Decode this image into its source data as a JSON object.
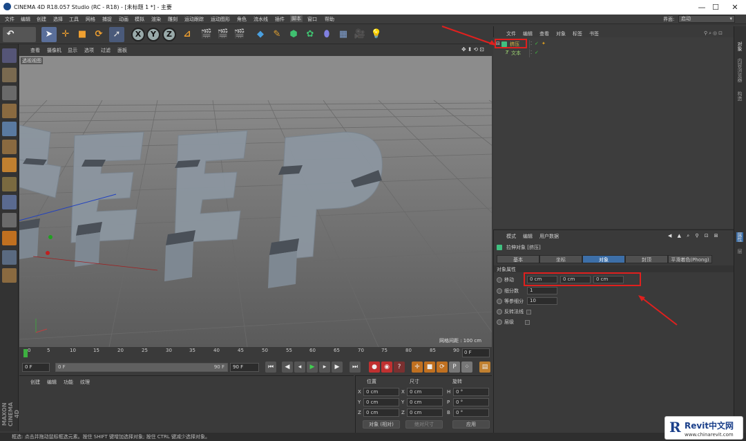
{
  "window": {
    "title": "CINEMA 4D R18.057 Studio (RC - R18) - [未标题 1 *] - 主要",
    "minimize": "—",
    "maximize": "☐",
    "close": "✕"
  },
  "menubar": {
    "items": [
      "文件",
      "编辑",
      "创建",
      "选择",
      "工具",
      "网格",
      "捕捉",
      "动画",
      "模拟",
      "渲染",
      "雕刻",
      "运动跟踪",
      "运动图形",
      "角色",
      "流水线",
      "插件",
      "脚本",
      "窗口",
      "帮助"
    ],
    "active": "脚本",
    "interface_label": "界面:",
    "interface_value": "启动"
  },
  "toolbar": {
    "axes": [
      "X",
      "Y",
      "Z"
    ]
  },
  "viewport": {
    "menu": [
      "查看",
      "摄像机",
      "显示",
      "选项",
      "过滤",
      "面板"
    ],
    "label": "透视视图",
    "grid_status": "网格间距 : 100 cm",
    "text3d": "KEEP"
  },
  "timeline": {
    "ticks": [
      "0",
      "5",
      "10",
      "15",
      "20",
      "25",
      "30",
      "35",
      "40",
      "45",
      "50",
      "55",
      "60",
      "65",
      "70",
      "75",
      "80",
      "85",
      "90"
    ],
    "frame_end": "0 F"
  },
  "transport": {
    "current": "0 F",
    "min": "0 F",
    "range_end": "90 F",
    "max": "90 F"
  },
  "material": {
    "menu": [
      "创建",
      "编辑",
      "功能",
      "纹理"
    ]
  },
  "coords": {
    "headers": [
      "位置",
      "尺寸",
      "旋转"
    ],
    "rows": [
      {
        "p": "X",
        "pv": "0 cm",
        "s": "X",
        "sv": "0 cm",
        "r": "H",
        "rv": "0 °"
      },
      {
        "p": "Y",
        "pv": "0 cm",
        "s": "Y",
        "sv": "0 cm",
        "r": "P",
        "rv": "0 °"
      },
      {
        "p": "Z",
        "pv": "0 cm",
        "s": "Z",
        "sv": "0 cm",
        "r": "B",
        "rv": "0 °"
      }
    ],
    "mode": "对象 (相对)",
    "size_mode": "绝对尺寸",
    "apply": "应用"
  },
  "objmgr": {
    "menu": [
      "文件",
      "编辑",
      "查看",
      "对象",
      "标签",
      "书签"
    ],
    "objects": [
      {
        "name": "挤压",
        "color": "#e8c040"
      },
      {
        "name": "文本",
        "color": "#9ad070"
      }
    ]
  },
  "attr": {
    "menu": [
      "模式",
      "编辑",
      "用户数据"
    ],
    "object_title": "拉伸对象 [挤压]",
    "tabs": [
      "基本",
      "坐标",
      "对象",
      "封顶",
      "平滑着色(Phong)"
    ],
    "active_tab": "对象",
    "section": "对象属性",
    "move_label": "移动",
    "move_values": [
      "0 cm",
      "0 cm",
      "0 cm"
    ],
    "subdiv_label": "细分数",
    "subdiv_value": "1",
    "iso_label": "等参细分",
    "iso_value": "10",
    "flip_label": "反转法线",
    "layer_label": "层级"
  },
  "rightstrip": [
    "对象",
    "内容浏览器",
    "构造",
    "属性",
    "层"
  ],
  "status": "框选: 点击并拖动鼠标框选元素。按住 SHIFT 键增加选择对象; 按住 CTRL 键减少选择对象。",
  "logo": {
    "brand": "Revit中文网",
    "url": "www.chinarevit.com"
  },
  "maxon": "MAXON CINEMA 4D",
  "colors": {
    "accent": "#3d6fa8",
    "highlight": "#e0201e"
  }
}
